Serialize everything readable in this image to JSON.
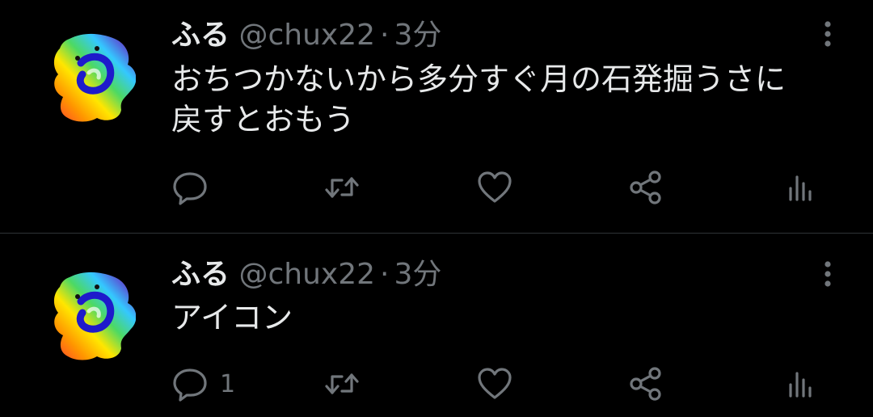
{
  "colors": {
    "background": "#000000",
    "text_primary": "#e7e9ea",
    "text_secondary": "#71767b",
    "divider": "#2f3336"
  },
  "tweets": [
    {
      "author_name": "ふる",
      "handle": "@chux22",
      "separator": "·",
      "time": "3分",
      "text_lines": [
        "おちつかないから多分すぐ月の石発掘うさに",
        "戻すとおもう"
      ],
      "reply_count": "",
      "icons": [
        "avatar",
        "more-icon",
        "reply-icon",
        "retweet-icon",
        "like-icon",
        "share-icon",
        "views-icon"
      ]
    },
    {
      "author_name": "ふる",
      "handle": "@chux22",
      "separator": "·",
      "time": "3分",
      "text_lines": [
        "アイコン"
      ],
      "reply_count": "1",
      "icons": [
        "avatar",
        "more-icon",
        "reply-icon",
        "retweet-icon",
        "like-icon",
        "share-icon",
        "views-icon"
      ]
    }
  ]
}
